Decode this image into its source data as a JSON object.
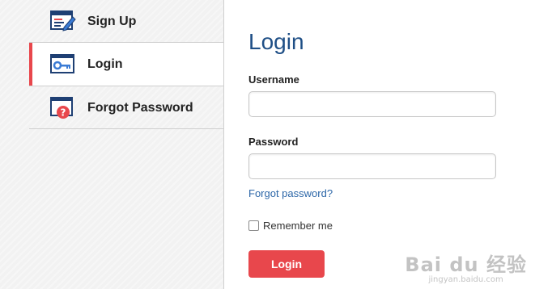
{
  "sidebar": {
    "items": [
      {
        "label": "Sign Up",
        "icon": "signup-form-icon",
        "active": false
      },
      {
        "label": "Login",
        "icon": "key-icon",
        "active": true
      },
      {
        "label": "Forgot Password",
        "icon": "question-window-icon",
        "active": false
      }
    ],
    "active_color": "#e8474c"
  },
  "main": {
    "title": "Login",
    "username_label": "Username",
    "username_value": "",
    "password_label": "Password",
    "password_value": "",
    "forgot_link": "Forgot password?",
    "remember_label": "Remember me",
    "remember_checked": false,
    "login_button": "Login"
  },
  "colors": {
    "title": "#1f4f86",
    "link": "#2d67a8",
    "button": "#e8474c"
  },
  "watermark": {
    "main": "Bai du 经验",
    "sub": "jingyan.baidu.com"
  }
}
